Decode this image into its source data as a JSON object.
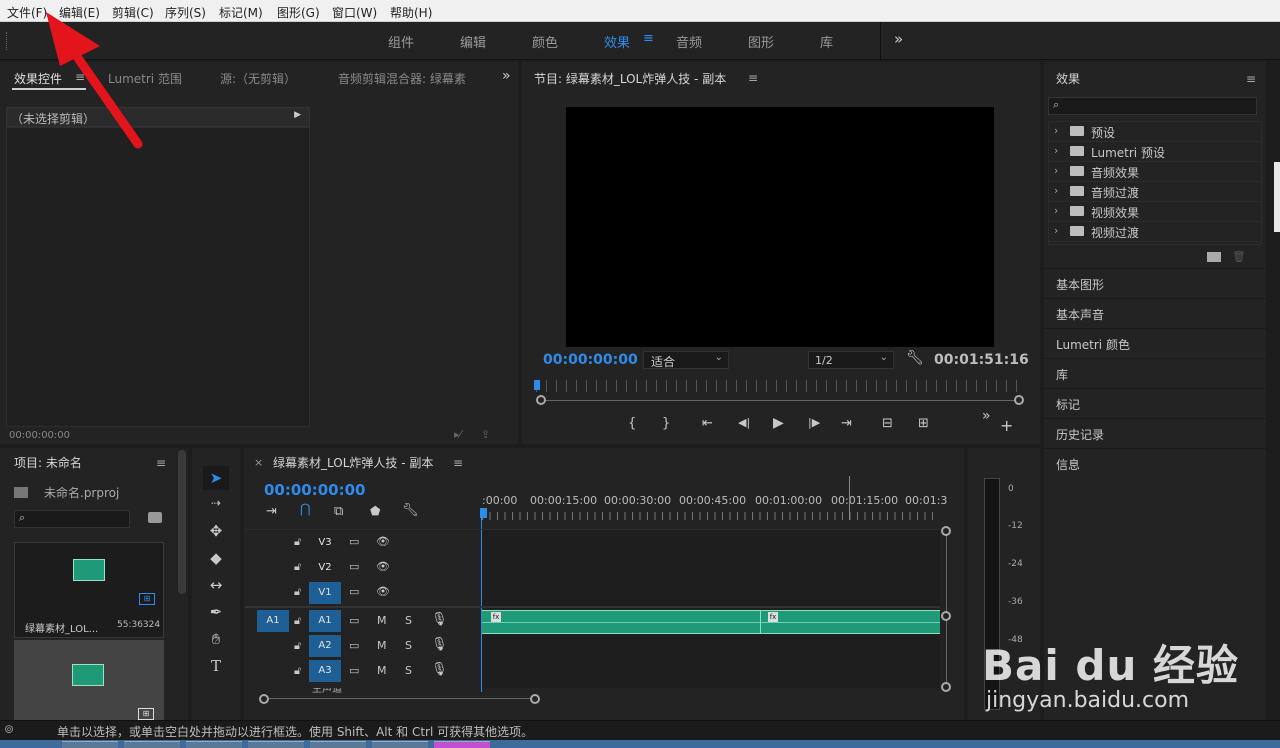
{
  "menu": [
    "文件(F)",
    "编辑(E)",
    "剪辑(C)",
    "序列(S)",
    "标记(M)",
    "图形(G)",
    "窗口(W)",
    "帮助(H)"
  ],
  "workspaces": [
    "组件",
    "编辑",
    "颜色",
    "效果",
    "音频",
    "图形",
    "库"
  ],
  "active_workspace": "效果",
  "source_panel": {
    "tabs": [
      "效果控件",
      "Lumetri 范围",
      "源:（无剪辑）",
      "音频剪辑混合器: 绿幕素"
    ],
    "no_clip": "（未选择剪辑）",
    "timecode": "00:00:00:00"
  },
  "program_monitor": {
    "title": "节目: 绿幕素材_LOL炸弹人技 - 副本",
    "timecode": "00:00:00:00",
    "fit": "适合",
    "resolution": "1/2",
    "duration": "00:01:51:16"
  },
  "effects_panel": {
    "title": "效果",
    "items": [
      "预设",
      "Lumetri 预设",
      "音频效果",
      "音频过渡",
      "视频效果",
      "视频过渡"
    ],
    "sections": [
      "基本图形",
      "基本声音",
      "Lumetri 颜色",
      "库",
      "标记",
      "历史记录",
      "信息"
    ]
  },
  "project_panel": {
    "title": "项目: 未命名",
    "file": "未命名.prproj",
    "clip_name": "绿幕素材_LOL...",
    "clip_duration": "55:36324"
  },
  "timeline": {
    "title": "绿幕素材_LOL炸弹人技 - 副本",
    "timecode": "00:00:00:00",
    "ruler": [
      ":00:00",
      "00:00:15:00",
      "00:00:30:00",
      "00:00:45:00",
      "00:01:00:00",
      "00:01:15:00",
      "00:01:3"
    ],
    "video_tracks": [
      "V3",
      "V2",
      "V1"
    ],
    "audio_tracks": [
      "A1",
      "A2",
      "A3"
    ],
    "source_patch": "A1",
    "master": "主声道",
    "clip_fx": "fx"
  },
  "meter_scale": [
    "0",
    "-12",
    "-24",
    "-36",
    "-48"
  ],
  "status_bar": "单击以选择，或单击空白处并拖动以进行框选。使用 Shift、Alt 和 Ctrl 可获得其他选项。",
  "watermark": {
    "brand": "Bai du 经验",
    "url": "jingyan.baidu.com"
  },
  "colors": {
    "accent": "#2d8ceb",
    "clip": "#1f9a78",
    "arrow": "#e3141b"
  }
}
